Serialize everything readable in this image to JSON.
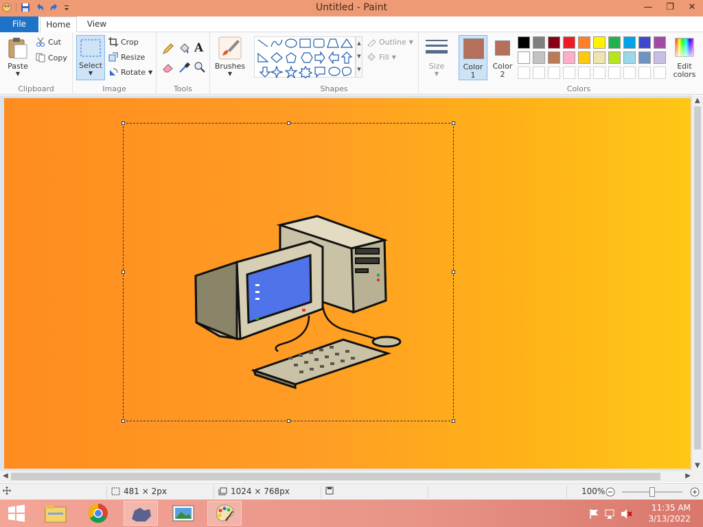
{
  "window": {
    "title": "Untitled - Paint",
    "controls": {
      "minimize": "—",
      "restore": "❐",
      "close": "✕"
    }
  },
  "ribbon_tabs": [
    {
      "label": "File"
    },
    {
      "label": "Home"
    },
    {
      "label": "View"
    }
  ],
  "clipboard": {
    "paste_label": "Paste",
    "cut_label": "Cut",
    "copy_label": "Copy",
    "group_label": "Clipboard"
  },
  "image": {
    "select_label": "Select",
    "crop_label": "Crop",
    "resize_label": "Resize",
    "rotate_label": "Rotate",
    "group_label": "Image"
  },
  "tools": {
    "group_label": "Tools",
    "items": [
      "pencil-icon",
      "fill-icon",
      "text-icon",
      "eraser-icon",
      "color-picker-icon",
      "magnifier-icon"
    ]
  },
  "brushes": {
    "label": "Brushes"
  },
  "shapes": {
    "group_label": "Shapes",
    "outline_label": "Outline",
    "fill_label": "Fill"
  },
  "size": {
    "label": "Size"
  },
  "colors": {
    "color1_label": "Color",
    "color1_num": "1",
    "color2_label": "Color",
    "color2_num": "2",
    "color1_value": "#b4705a",
    "color2_value": "#b4705a",
    "group_label": "Colors",
    "edit_label": "Edit",
    "edit_label2": "colors",
    "palette_row1": [
      "#000000",
      "#7f7f7f",
      "#880015",
      "#ed1c24",
      "#ff7f27",
      "#fff200",
      "#22b14c",
      "#00a2e8",
      "#3f48cc",
      "#a349a4"
    ],
    "palette_row2": [
      "#ffffff",
      "#c3c3c3",
      "#b97a57",
      "#ffaec9",
      "#ffc90e",
      "#efe4b0",
      "#b5e61d",
      "#99d9ea",
      "#7092be",
      "#c8bfe7"
    ],
    "palette_row3": [
      "#ffffff",
      "#ffffff",
      "#ffffff",
      "#ffffff",
      "#ffffff",
      "#ffffff",
      "#ffffff",
      "#ffffff",
      "#ffffff",
      "#ffffff"
    ]
  },
  "status": {
    "selection_size": "481 × 2px",
    "image_size": "1024 × 768px",
    "zoom": "100%"
  },
  "taskbar": {
    "time": "11:35 AM",
    "date": "3/13/2022"
  }
}
